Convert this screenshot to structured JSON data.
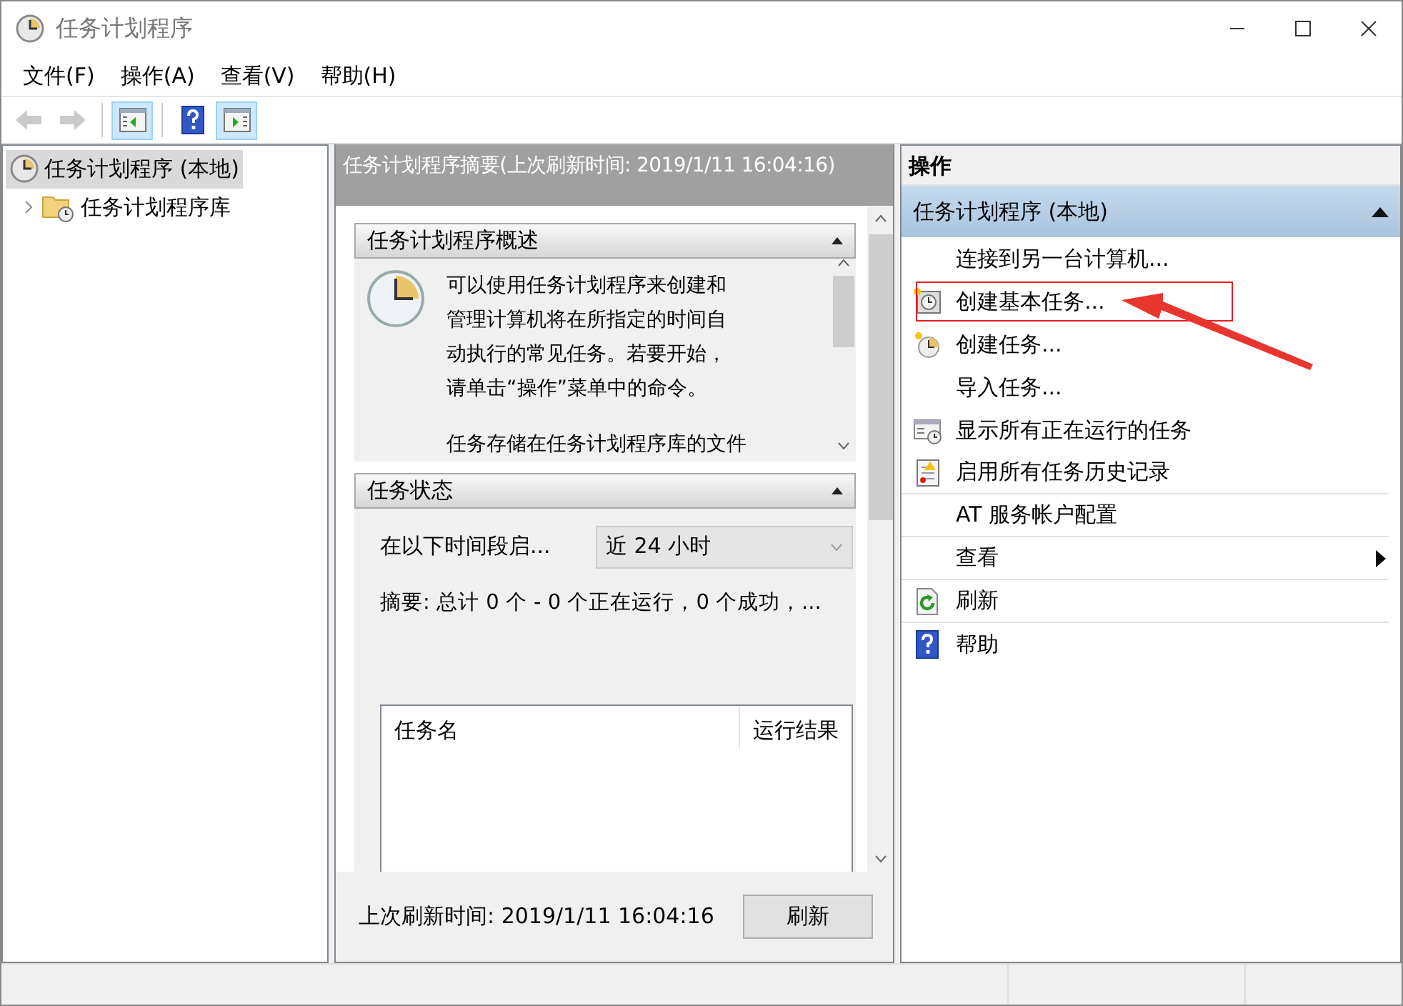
{
  "window": {
    "title": "任务计划程序"
  },
  "menu": [
    {
      "label": "文件(F)"
    },
    {
      "label": "操作(A)"
    },
    {
      "label": "查看(V)"
    },
    {
      "label": "帮助(H)"
    }
  ],
  "toolbar": [
    {
      "kind": "back",
      "disabled": true,
      "pressed": false
    },
    {
      "kind": "forward",
      "disabled": true,
      "pressed": false
    },
    {
      "kind": "console-tree",
      "disabled": false,
      "pressed": true
    },
    {
      "kind": "help",
      "disabled": false,
      "pressed": false
    },
    {
      "kind": "action-pane",
      "disabled": false,
      "pressed": true
    }
  ],
  "tree": {
    "label": "任务计划程序 (本地)",
    "selected": true,
    "children": [
      {
        "label": "任务计划程序库",
        "selected": false,
        "expanded": false
      }
    ]
  },
  "summary": {
    "title": "任务计划程序摘要(上次刷新时间: 2019/1/11 16:04:16)",
    "overview": {
      "title": "任务计划程序概述",
      "expanded": true,
      "paragraphs": [
        "可以使用任务计划程序来创建和管理计算机将在所指定的时间自动执行的常见任务。若要开始，请单击“操作”菜单中的命令。",
        "任务存储在任务计划程序库的文件"
      ]
    },
    "status": {
      "title": "任务状态",
      "expanded": true,
      "period_label": "在以下时间段启...",
      "period_value": "近 24 小时",
      "summary": "摘要: 总计 0 个 - 0 个正在运行，0 个成功，...",
      "columns": [
        "任务名",
        "运行结果"
      ]
    },
    "last_refresh": "上次刷新时间: 2019/1/11 16:04:16",
    "refresh_button": "刷新"
  },
  "actions": {
    "title": "操作",
    "section": {
      "label": "任务计划程序 (本地)",
      "expanded": true
    },
    "items": [
      {
        "label": "连接到另一台计算机...",
        "kind": "plain",
        "divider": false,
        "highlighted": false
      },
      {
        "label": "创建基本任务...",
        "kind": "basic-task",
        "divider": false,
        "highlighted": true
      },
      {
        "label": "创建任务...",
        "kind": "task",
        "divider": false,
        "highlighted": false
      },
      {
        "label": "导入任务...",
        "kind": "plain",
        "divider": false,
        "highlighted": false
      },
      {
        "label": "显示所有正在运行的任务",
        "kind": "running",
        "divider": false,
        "highlighted": false
      },
      {
        "label": "启用所有任务历史记录",
        "kind": "history",
        "divider": true,
        "highlighted": false
      },
      {
        "label": "AT 服务帐户配置",
        "kind": "plain",
        "divider": true,
        "highlighted": false
      },
      {
        "label": "查看",
        "kind": "submenu",
        "divider": true,
        "highlighted": false
      },
      {
        "label": "刷新",
        "kind": "refresh",
        "divider": true,
        "highlighted": false
      },
      {
        "label": "帮助",
        "kind": "help",
        "divider": false,
        "highlighted": false
      }
    ]
  }
}
